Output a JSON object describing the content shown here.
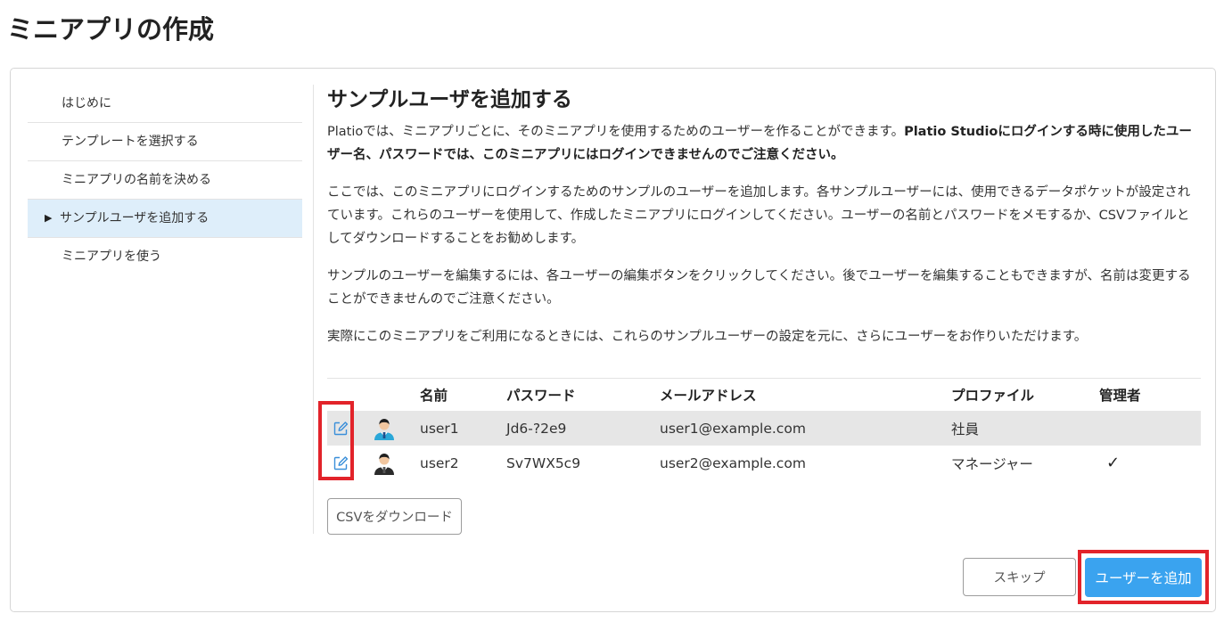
{
  "page": {
    "title": "ミニアプリの作成"
  },
  "sidebar": {
    "items": [
      {
        "label": "はじめに",
        "active": false
      },
      {
        "label": "テンプレートを選択する",
        "active": false
      },
      {
        "label": "ミニアプリの名前を決める",
        "active": false
      },
      {
        "label": "サンプルユーザを追加する",
        "active": true
      },
      {
        "label": "ミニアプリを使う",
        "active": false
      }
    ],
    "active_marker": "▶"
  },
  "content": {
    "title": "サンプルユーザを追加する",
    "para1_normal": "Platioでは、ミニアプリごとに、そのミニアプリを使用するためのユーザーを作ることができます。",
    "para1_bold": "Platio Studioにログインする時に使用したユーザー名、パスワードでは、このミニアプリにはログインできませんのでご注意ください。",
    "para2": "ここでは、このミニアプリにログインするためのサンプルのユーザーを追加します。各サンプルユーザーには、使用できるデータポケットが設定されています。これらのユーザーを使用して、作成したミニアプリにログインしてください。ユーザーの名前とパスワードをメモするか、CSVファイルとしてダウンロードすることをお勧めします。",
    "para3": "サンプルのユーザーを編集するには、各ユーザーの編集ボタンをクリックしてください。後でユーザーを編集することもできますが、名前は変更することができませんのでご注意ください。",
    "para4": "実際にこのミニアプリをご利用になるときには、これらのサンプルユーザーの設定を元に、さらにユーザーをお作りいただけます。"
  },
  "table": {
    "columns": {
      "name": "名前",
      "password": "パスワード",
      "email": "メールアドレス",
      "profile": "プロファイル",
      "admin": "管理者"
    },
    "rows": [
      {
        "name": "user1",
        "password": "Jd6-?2e9",
        "email": "user1@example.com",
        "profile": "社員",
        "admin": "",
        "avatar_icon": "user-avatar-blue-icon",
        "edit_icon": "edit-icon"
      },
      {
        "name": "user2",
        "password": "Sv7WX5c9",
        "email": "user2@example.com",
        "profile": "マネージャー",
        "admin": "✓",
        "avatar_icon": "user-avatar-dark-icon",
        "edit_icon": "edit-icon"
      }
    ]
  },
  "buttons": {
    "csv_download": "CSVをダウンロード",
    "skip": "スキップ",
    "add_user": "ユーザーを追加"
  },
  "colors": {
    "accent": "#3aa3ef",
    "active_nav_bg": "#deeefa",
    "highlight": "#e2232a",
    "shaded_row": "#e6e6e6"
  }
}
